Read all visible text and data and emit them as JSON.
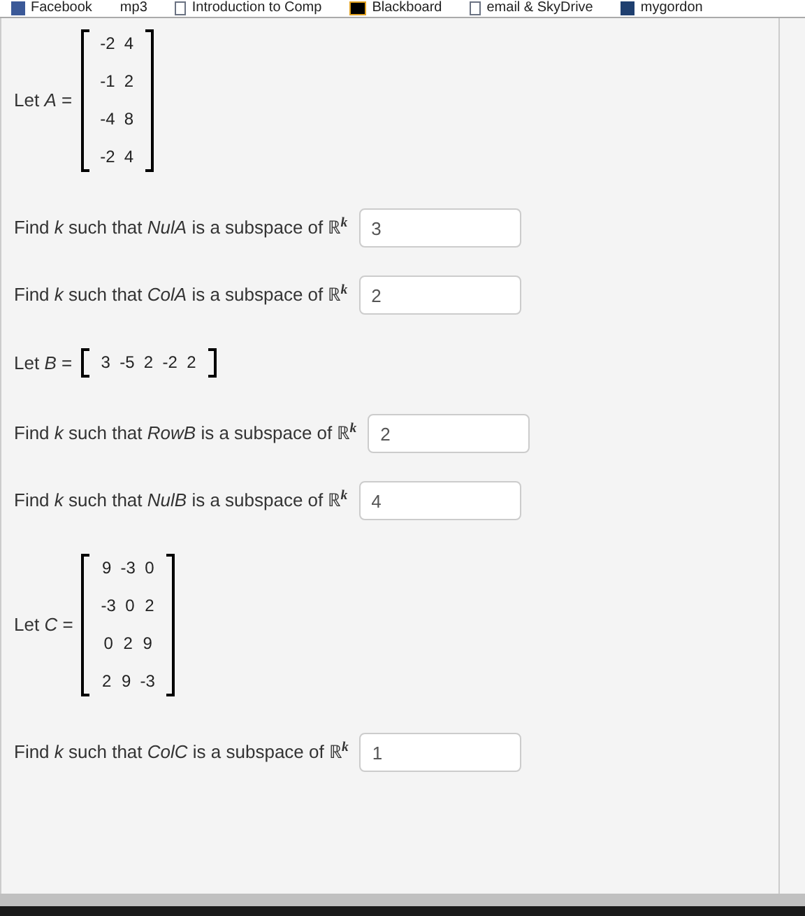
{
  "bookmarks": [
    {
      "label": "Facebook",
      "kind": "facebook"
    },
    {
      "label": "mp3",
      "kind": "none"
    },
    {
      "label": "Introduction to Comp",
      "kind": "page"
    },
    {
      "label": "Blackboard",
      "kind": "blackboard"
    },
    {
      "label": "email & SkyDrive",
      "kind": "page"
    },
    {
      "label": "mygordon",
      "kind": "mygordon"
    }
  ],
  "blocks": [
    {
      "kind": "matrix",
      "label": "Let *A* =",
      "rows": [
        [
          "-2",
          "4"
        ],
        [
          "-1",
          "2"
        ],
        [
          "-4",
          "8"
        ],
        [
          "-2",
          "4"
        ]
      ]
    },
    {
      "kind": "question",
      "text": "Find *k* such that *NulA* is a subspace of ℝ$^{k}$",
      "value": "3"
    },
    {
      "kind": "question",
      "text": "Find *k* such that *ColA* is a subspace of ℝ$^{k}$",
      "value": "2"
    },
    {
      "kind": "matrix",
      "label": "Let *B* =",
      "rows": [
        [
          "3",
          "-5",
          "2",
          "-2",
          "2"
        ]
      ]
    },
    {
      "kind": "question",
      "text": "Find *k* such that *RowB* is a subspace of ℝ$^{k}$",
      "value": "2"
    },
    {
      "kind": "question",
      "text": "Find *k* such that *NulB* is a subspace of ℝ$^{k}$",
      "value": "4"
    },
    {
      "kind": "matrix",
      "label": "Let *C* =",
      "rows": [
        [
          "9",
          "-3",
          "0"
        ],
        [
          "-3",
          "0",
          "2"
        ],
        [
          "0",
          "2",
          "9"
        ],
        [
          "2",
          "9",
          "-3"
        ]
      ]
    },
    {
      "kind": "question",
      "text": "Find *k* such that *ColC* is a subspace of ℝ$^{k}$",
      "value": "1"
    }
  ]
}
